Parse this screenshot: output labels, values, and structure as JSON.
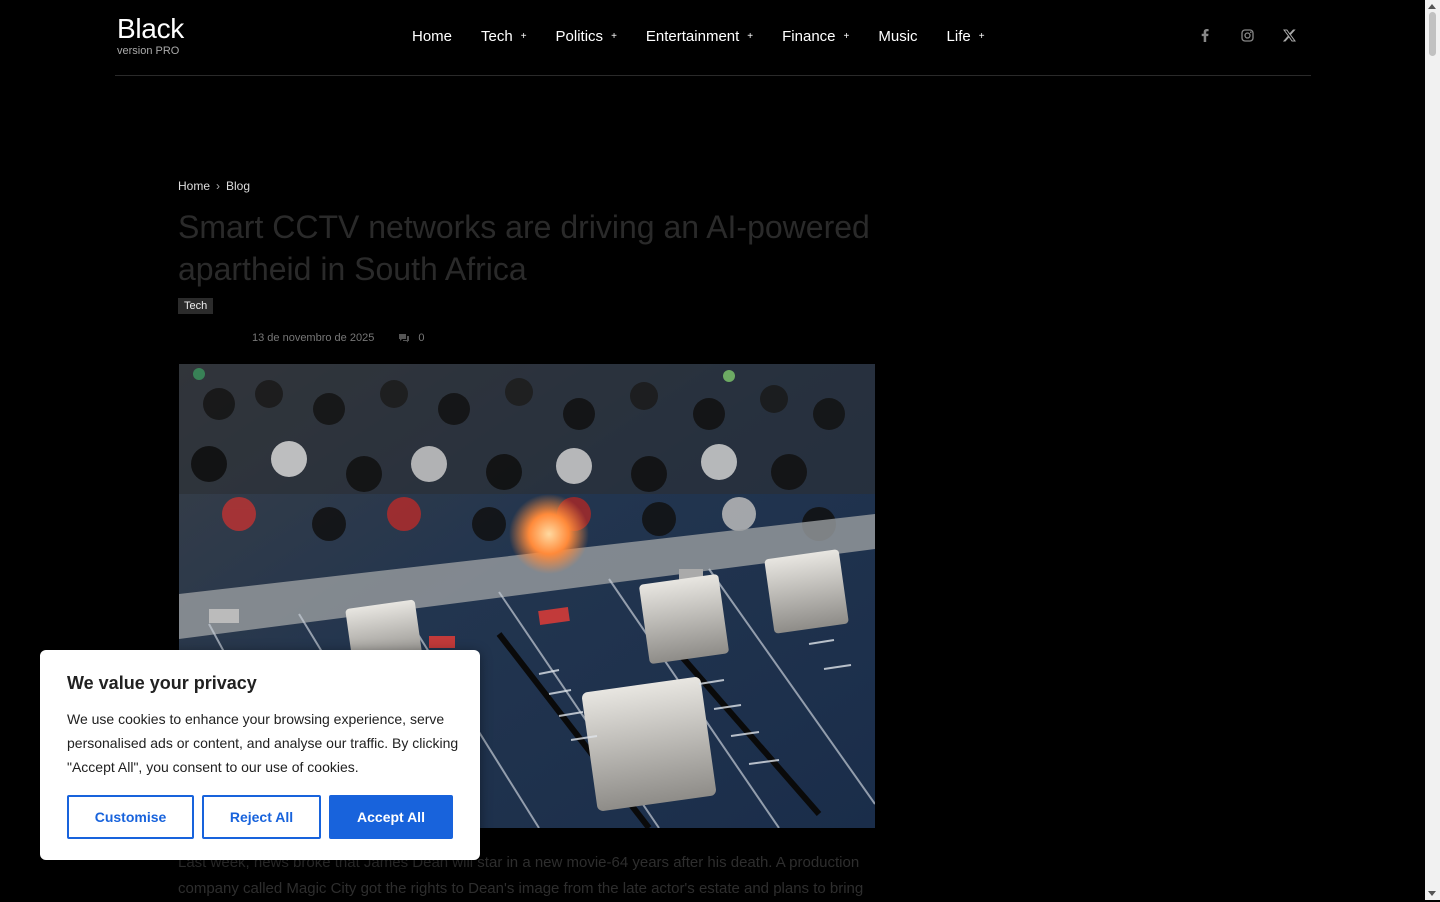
{
  "site": {
    "name": "Black",
    "tagline": "version PRO"
  },
  "nav": {
    "items": [
      {
        "label": "Home",
        "has_sub": false
      },
      {
        "label": "Tech",
        "has_sub": true
      },
      {
        "label": "Politics",
        "has_sub": true
      },
      {
        "label": "Entertainment",
        "has_sub": true
      },
      {
        "label": "Finance",
        "has_sub": true
      },
      {
        "label": "Music",
        "has_sub": false
      },
      {
        "label": "Life",
        "has_sub": true
      }
    ],
    "plus": "+"
  },
  "social": [
    "facebook-icon",
    "instagram-icon",
    "x-twitter-icon"
  ],
  "breadcrumb": {
    "home": "Home",
    "sep": "›",
    "current": "Blog"
  },
  "article": {
    "title": "Smart CCTV networks are driving an AI-powered apartheid in South Africa",
    "category": "Tech",
    "date": "13 de novembro de 2025",
    "comments": "0",
    "body": "Last week, news broke that James Dean will star in a new movie-64 years after his death. A production company called Magic City got the rights to Dean's image from the late actor's estate and plans to bring"
  },
  "cookie": {
    "title": "We value your privacy",
    "text": "We use cookies to enhance your browsing experience, serve personalised ads or content, and analyse our traffic. By clicking \"Accept All\", you consent to our use of cookies.",
    "customise": "Customise",
    "reject": "Reject All",
    "accept": "Accept All"
  },
  "colors": {
    "accent": "#1863dc",
    "background": "#000000"
  }
}
